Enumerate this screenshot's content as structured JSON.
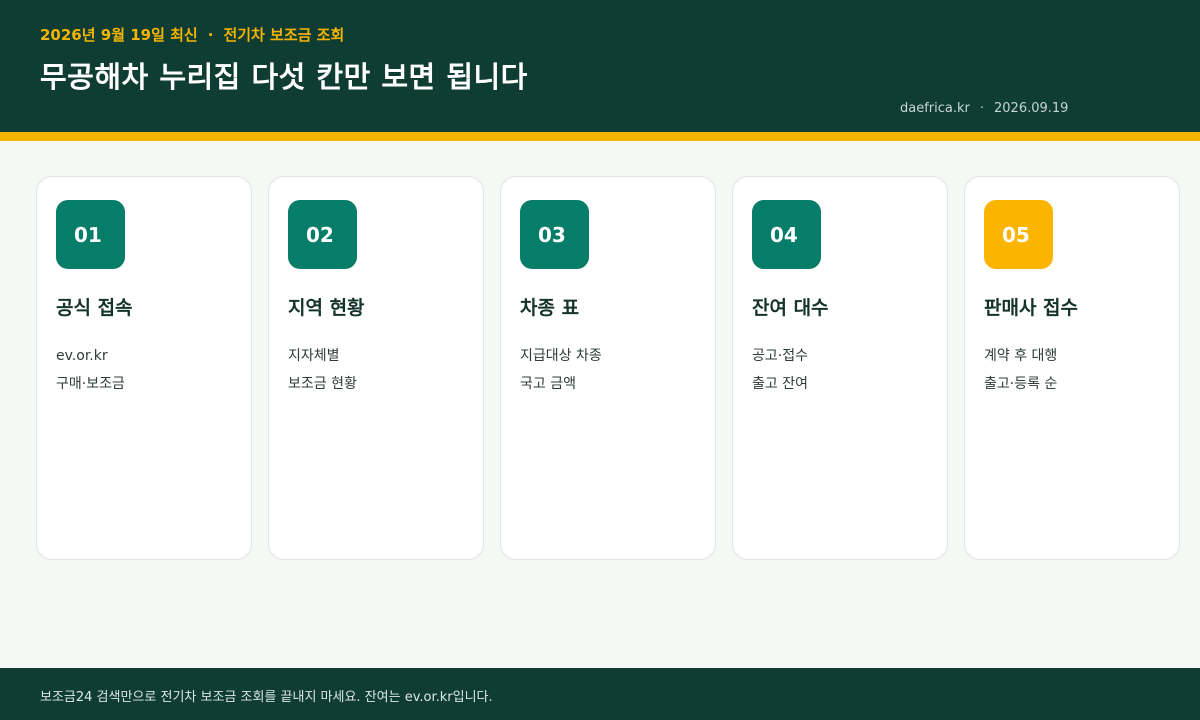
{
  "header": {
    "date_label": "2026년 9월 19일 최신",
    "separator": "·",
    "topic": "전기차 보조금 조회",
    "title": "무공해차 누리집 다섯 칸만 보면 됩니다",
    "site": "daefrica.kr",
    "date": "2026.09.19"
  },
  "colors": {
    "header_bg": "#0f3d33",
    "accent": "#f5b400",
    "badge": "#067d68",
    "page_bg": "#f6f8f6"
  },
  "cards": [
    {
      "number": "01",
      "title": "공식 접속",
      "lines": [
        "ev.or.kr",
        "구매·보조금"
      ]
    },
    {
      "number": "02",
      "title": "지역 현황",
      "lines": [
        "지자체별",
        "보조금 현황"
      ]
    },
    {
      "number": "03",
      "title": "차종 표",
      "lines": [
        "지급대상 차종",
        "국고 금액"
      ]
    },
    {
      "number": "04",
      "title": "잔여 대수",
      "lines": [
        "공고·접수",
        "출고 잔여"
      ]
    },
    {
      "number": "05",
      "title": "판매사 접수",
      "lines": [
        "계약 후 대행",
        "출고·등록 순"
      ]
    }
  ],
  "footer": {
    "text": "보조금24 검색만으로 전기차 보조금 조회를 끝내지 마세요. 잔여는 ev.or.kr입니다."
  }
}
